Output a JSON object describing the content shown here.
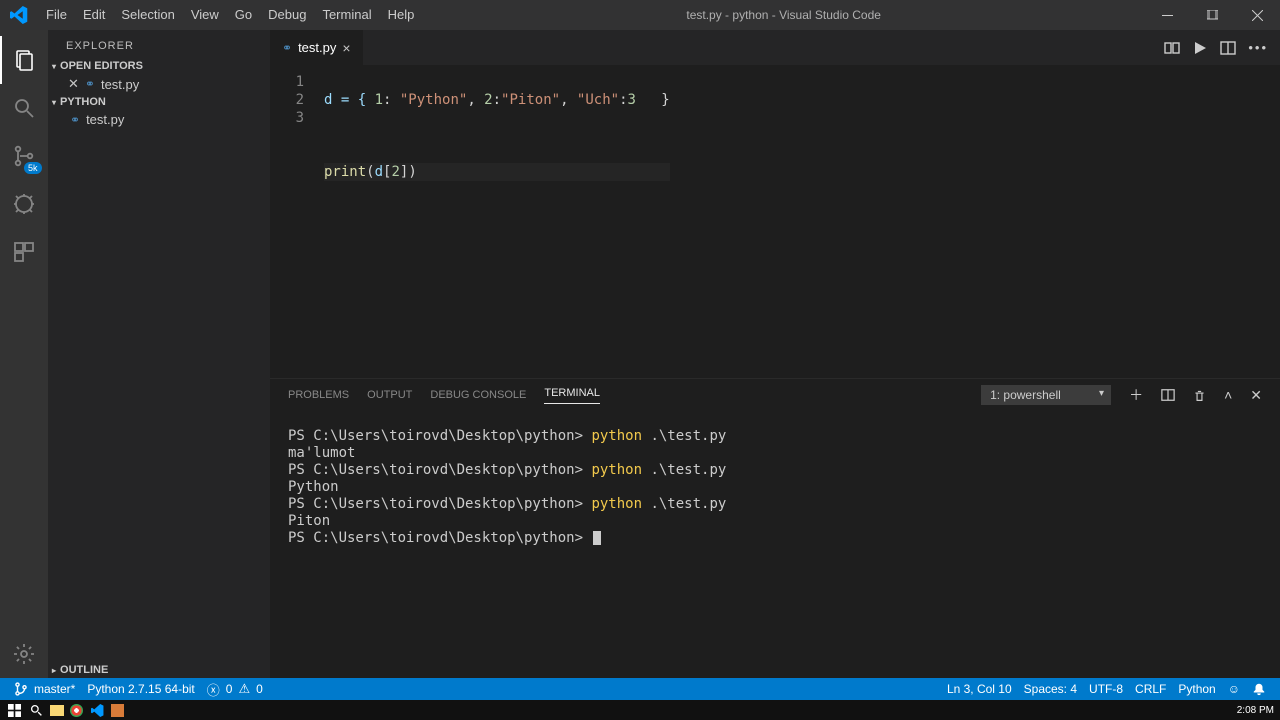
{
  "window": {
    "title": "test.py - python - Visual Studio Code"
  },
  "menu": {
    "file": "File",
    "edit": "Edit",
    "selection": "Selection",
    "view": "View",
    "go": "Go",
    "debug": "Debug",
    "terminal": "Terminal",
    "help": "Help"
  },
  "activity": {
    "scm_badge": "5k"
  },
  "sidebar": {
    "title": "EXPLORER",
    "open_editors": "OPEN EDITORS",
    "open_editor_item": "test.py",
    "workspace": "PYTHON",
    "file_item": "test.py",
    "outline": "OUTLINE"
  },
  "tab": {
    "filename": "test.py"
  },
  "editor": {
    "line_numbers": [
      "1",
      "2",
      "3"
    ],
    "line1": {
      "p1": "d = { ",
      "k1": "1",
      "p2": ": ",
      "v1": "\"Python\"",
      "p3": ", ",
      "k2": "2",
      "p4": ":",
      "v2": "\"Piton\"",
      "p5": ", ",
      "v3": "\"Uch\"",
      "p6": ":",
      "k3": "3",
      "p7": "   }"
    },
    "line3": {
      "fn": "print",
      "open": "(",
      "id": "d",
      "br_open": "[",
      "idx": "2",
      "br_close": "]",
      "close": ")"
    }
  },
  "panel": {
    "tabs": {
      "problems": "PROBLEMS",
      "output": "OUTPUT",
      "debug_console": "DEBUG CONSOLE",
      "terminal": "TERMINAL"
    },
    "dropdown": "1: powershell",
    "terminal_lines": {
      "prompt": "PS C:\\Users\\toirovd\\Desktop\\python> ",
      "cmd_py": "python",
      "cmd_arg": " .\\test.py",
      "out1": "ma'lumot",
      "out2": "Python",
      "out3": "Piton"
    }
  },
  "status": {
    "branch": "master*",
    "python": "Python 2.7.15 64-bit",
    "errors": "0",
    "warnings": "0",
    "ln_col": "Ln 3, Col 10",
    "spaces": "Spaces: 4",
    "encoding": "UTF-8",
    "eol": "CRLF",
    "lang": "Python",
    "feedback": "☺"
  },
  "taskbar": {
    "time": "2:08 PM"
  }
}
